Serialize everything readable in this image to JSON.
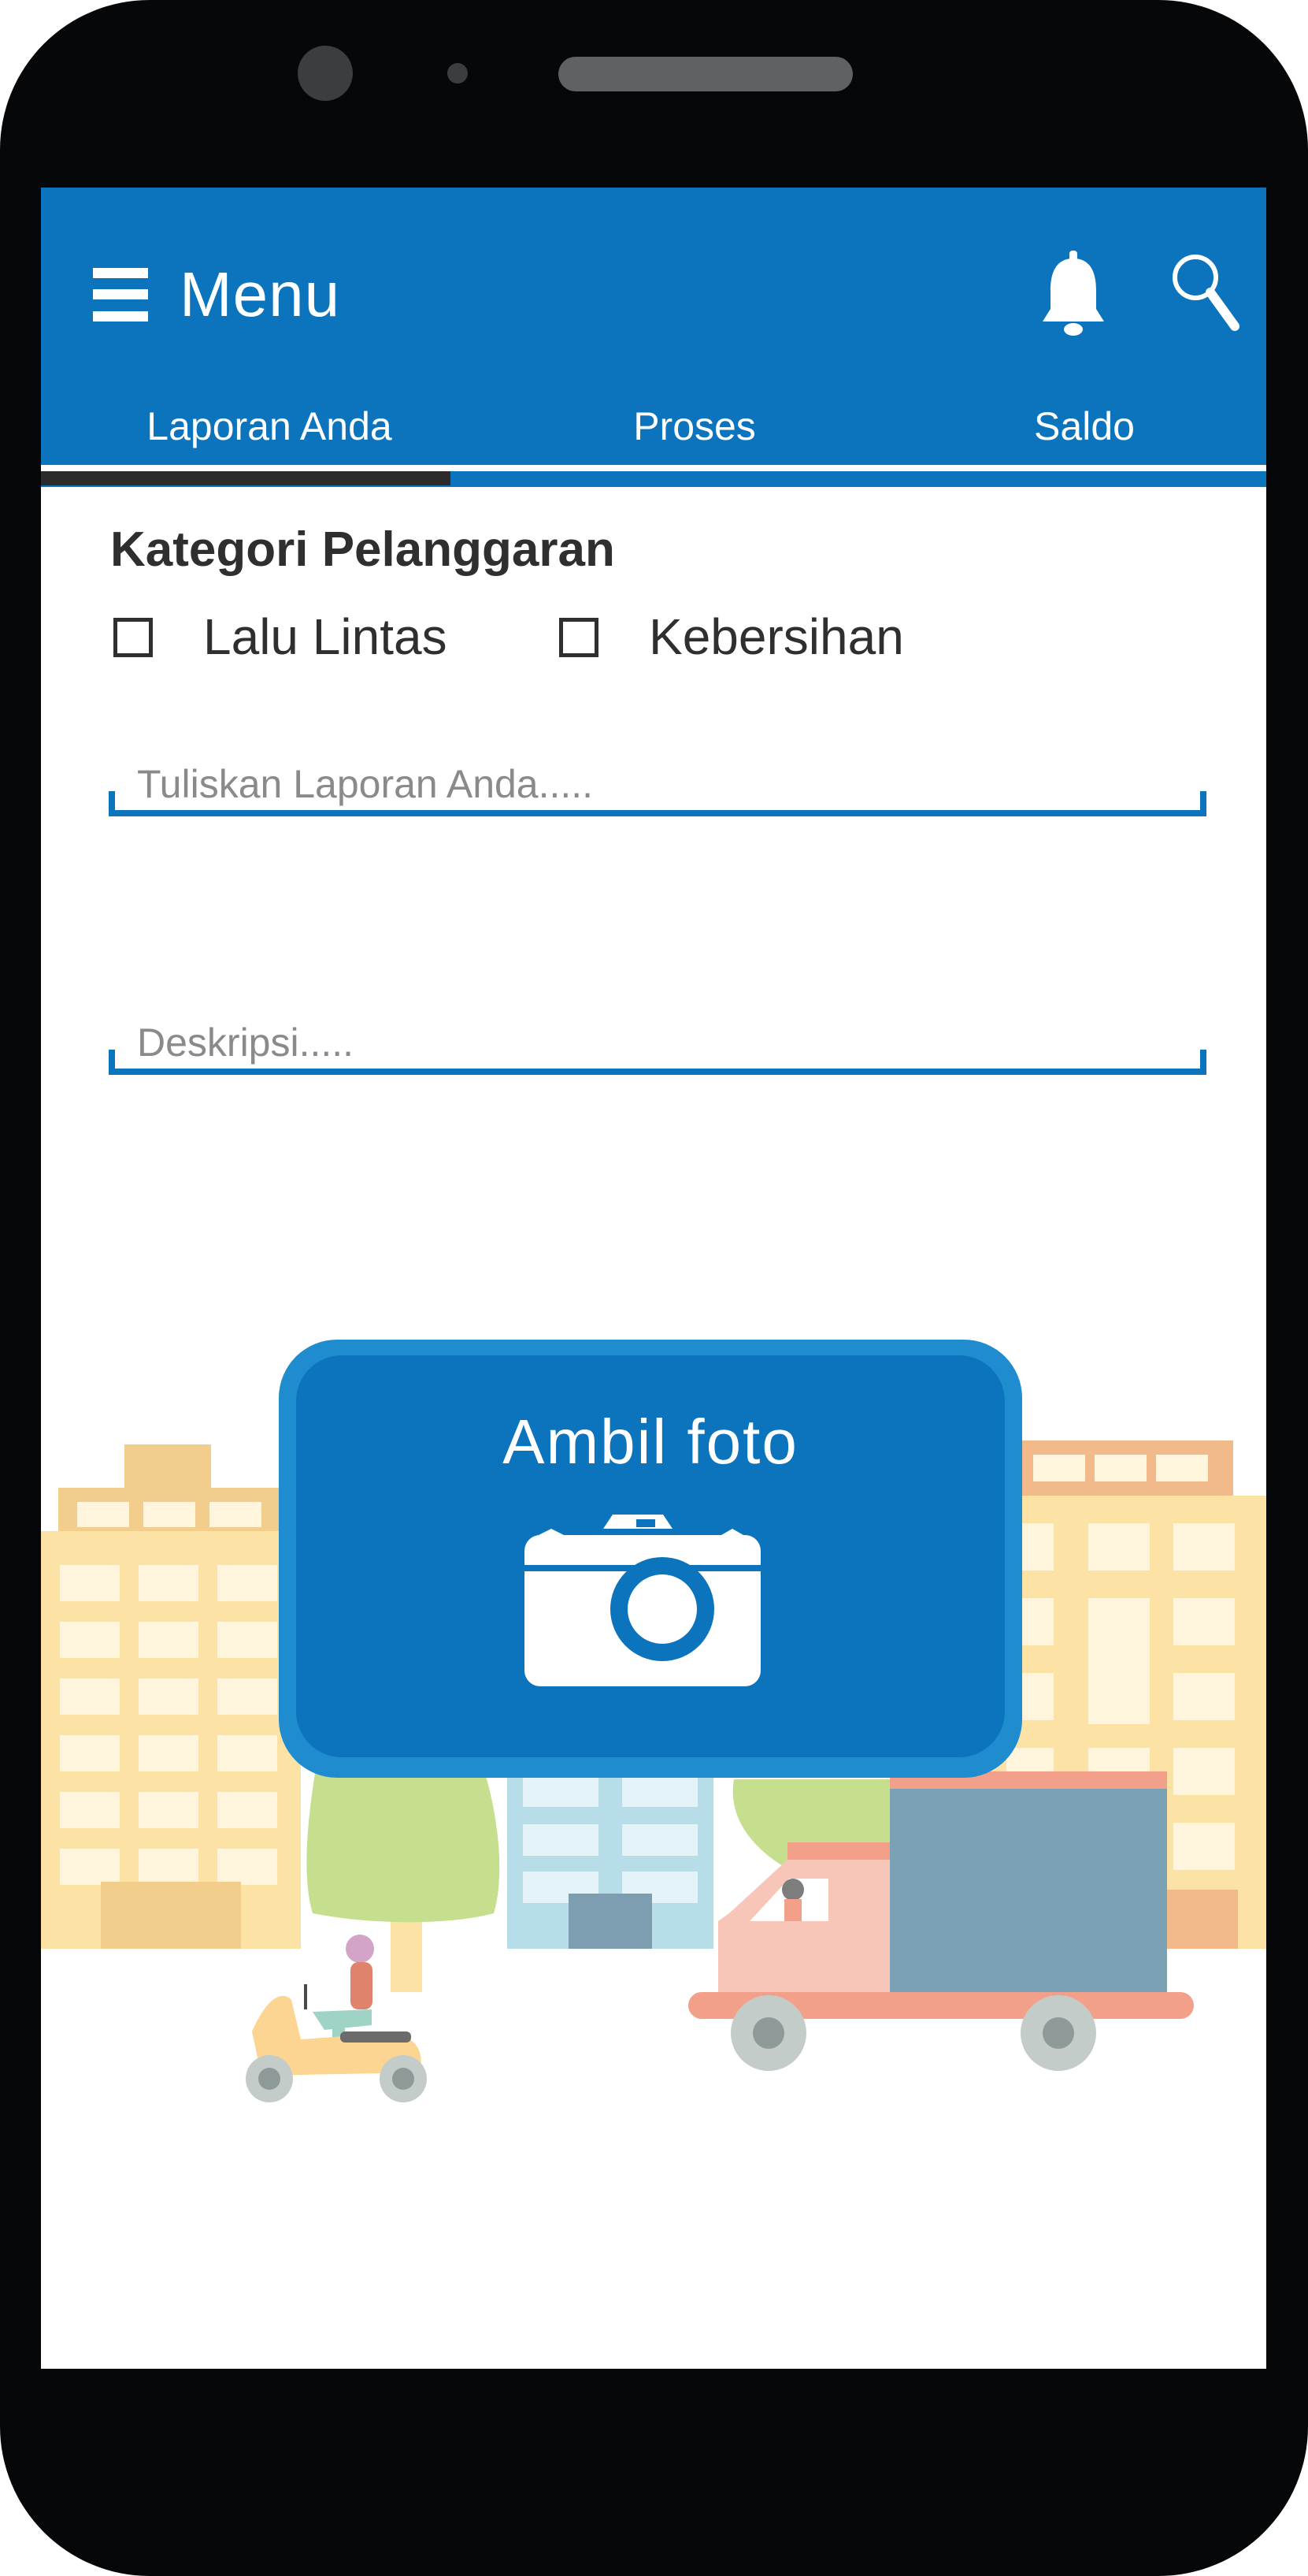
{
  "appbar": {
    "title": "Menu",
    "icons": [
      "menu-icon",
      "bell-icon",
      "search-icon"
    ],
    "background_color": "#0b74bd"
  },
  "tabs": [
    {
      "label": "Laporan Anda",
      "active": true
    },
    {
      "label": "Proses",
      "active": false
    },
    {
      "label": "Saldo",
      "active": false
    }
  ],
  "form": {
    "category_title": "Kategori Pelanggaran",
    "categories": [
      {
        "label": "Lalu Lintas",
        "checked": false
      },
      {
        "label": "Kebersihan",
        "checked": false
      }
    ],
    "report_placeholder": "Tuliskan Laporan Anda.....",
    "description_placeholder": "Deskripsi....."
  },
  "photo_button": {
    "label": "Ambil foto",
    "icon": "camera-icon"
  },
  "colors": {
    "accent": "#0b74bd",
    "accent_light": "#1e8ccf",
    "tab_indicator": "#2d2a2a",
    "text": "#2f2f2f"
  }
}
